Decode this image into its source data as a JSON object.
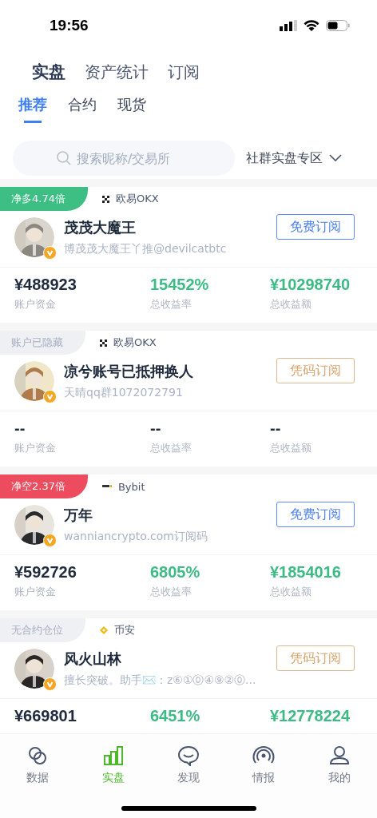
{
  "status_bar": {
    "time": "19:56"
  },
  "top_tabs": [
    {
      "label": "实盘",
      "selected": true
    },
    {
      "label": "资产统计",
      "selected": false
    },
    {
      "label": "订阅",
      "selected": false
    }
  ],
  "sub_tabs": [
    {
      "label": "推荐",
      "selected": true
    },
    {
      "label": "合约",
      "selected": false
    },
    {
      "label": "现货",
      "selected": false
    }
  ],
  "search": {
    "placeholder": "搜索昵称/交易所"
  },
  "filter": {
    "label": "社群实盘专区"
  },
  "traders": [
    {
      "tag": {
        "text": "净多4.74倍",
        "kind": "long"
      },
      "exchange": {
        "name": "欧易OKX",
        "kind": "okx"
      },
      "name": "茂茂大魔王",
      "bio": "博茂茂大魔王丫推@devilcatbtc",
      "verified": true,
      "avatar": {
        "kind": "picture"
      },
      "button": {
        "label": "免费订阅",
        "kind": "free"
      },
      "stats": [
        {
          "value": "¥488923",
          "label": "账户资金",
          "kind": "neutral"
        },
        {
          "value": "15452%",
          "label": "总收益率",
          "kind": "gain"
        },
        {
          "value": "¥10298740",
          "label": "总收益额",
          "kind": "gain"
        }
      ]
    },
    {
      "tag": {
        "text": "账户已隐藏",
        "kind": "muted"
      },
      "exchange": {
        "name": "欧易OKX",
        "kind": "okx"
      },
      "name": "凉兮账号已抵押换人",
      "bio": "天晴qq群1072072791",
      "verified": true,
      "avatar": {
        "kind": "picture"
      },
      "button": {
        "label": "凭码订阅",
        "kind": "code"
      },
      "stats": [
        {
          "value": "--",
          "label": "账户资金",
          "kind": "neutral"
        },
        {
          "value": "--",
          "label": "总收益率",
          "kind": "neutral"
        },
        {
          "value": "--",
          "label": "总收益额",
          "kind": "neutral"
        }
      ]
    },
    {
      "tag": {
        "text": "净空2.37倍",
        "kind": "short"
      },
      "exchange": {
        "name": "Bybit",
        "kind": "bybit"
      },
      "name": "万年",
      "bio": "wanniancrypto.com订阅码",
      "verified": true,
      "avatar": {
        "kind": "picture"
      },
      "button": {
        "label": "免费订阅",
        "kind": "free"
      },
      "stats": [
        {
          "value": "¥592726",
          "label": "账户资金",
          "kind": "neutral"
        },
        {
          "value": "6805%",
          "label": "总收益率",
          "kind": "gain"
        },
        {
          "value": "¥1854016",
          "label": "总收益额",
          "kind": "gain"
        }
      ]
    },
    {
      "tag": {
        "text": "无合约仓位",
        "kind": "muted"
      },
      "exchange": {
        "name": "币安",
        "kind": "binance"
      },
      "name": "风火山林",
      "bio": "擅长突破。助手✉️：z⑥①⓪④⑨②⓪...",
      "verified": true,
      "avatar": {
        "kind": "picture"
      },
      "button": {
        "label": "凭码订阅",
        "kind": "code"
      },
      "stats": [
        {
          "value": "¥669801",
          "kind": "neutral"
        },
        {
          "value": "6451%",
          "kind": "gain"
        },
        {
          "value": "¥12778224",
          "kind": "gain"
        }
      ]
    }
  ],
  "tab_bar": [
    {
      "label": "数据",
      "kind": "circles",
      "selected": false
    },
    {
      "label": "实盘",
      "kind": "bars",
      "selected": true
    },
    {
      "label": "发现",
      "kind": "chat",
      "selected": false
    },
    {
      "label": "情报",
      "kind": "signal",
      "selected": false
    },
    {
      "label": "我的",
      "kind": "person",
      "selected": false
    }
  ]
}
